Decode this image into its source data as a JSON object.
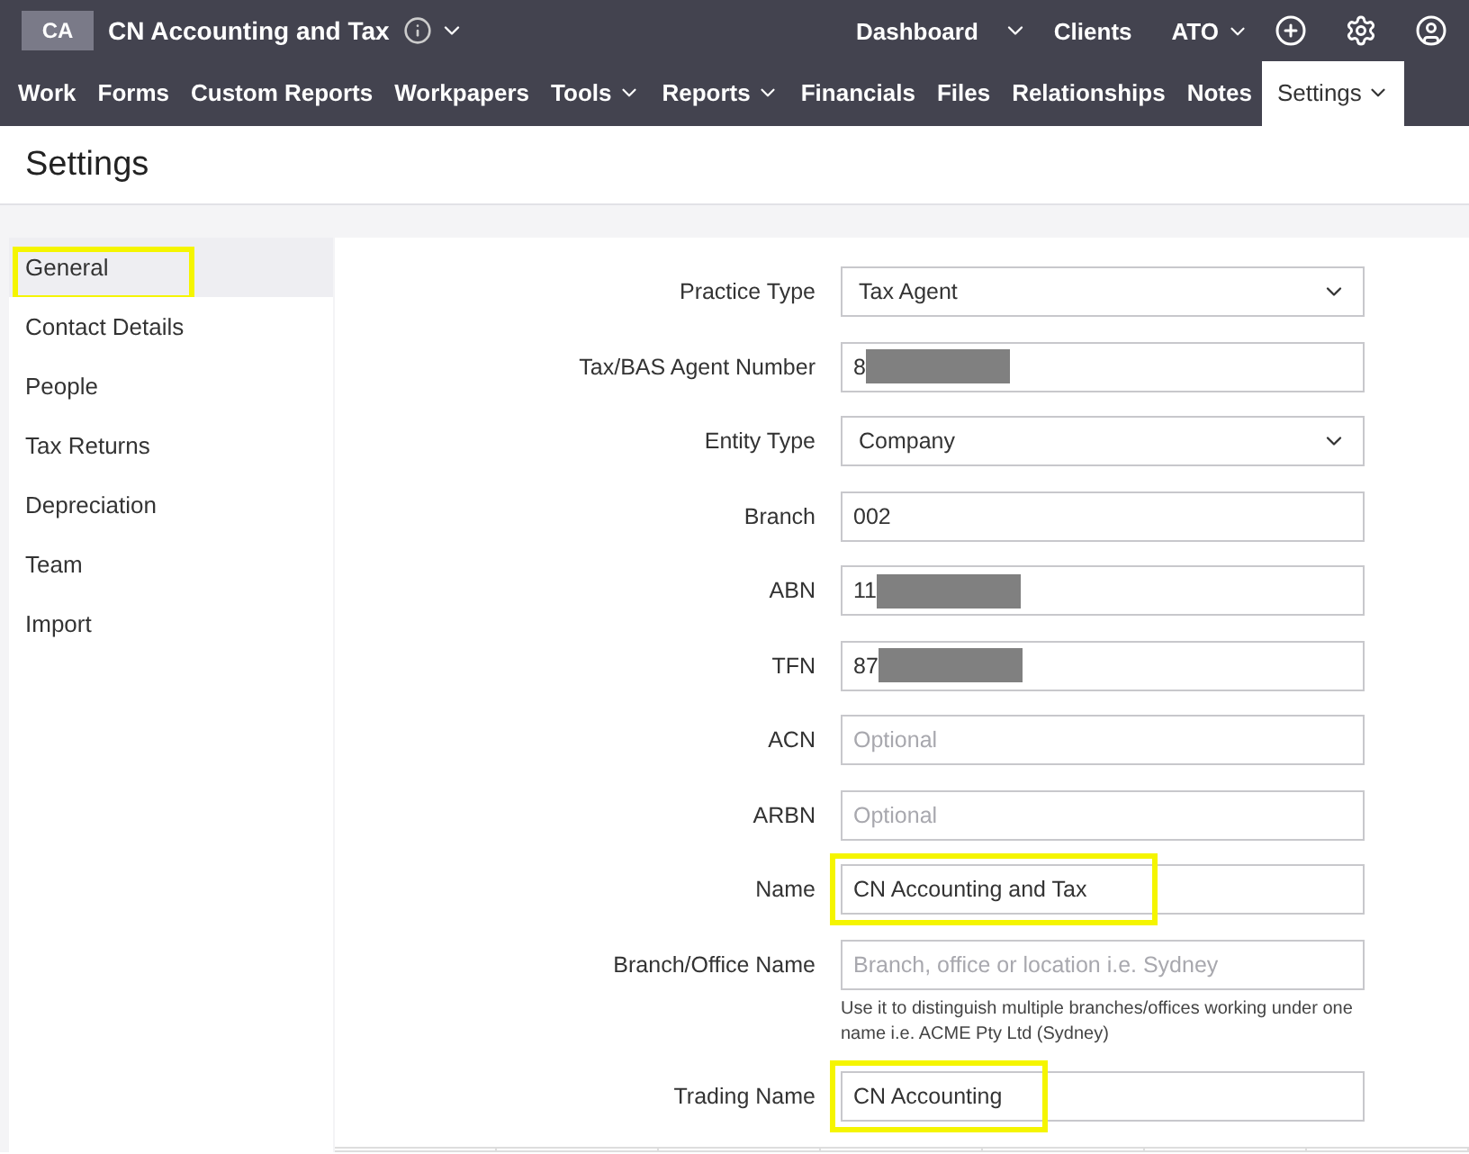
{
  "topbar": {
    "badge": "CA",
    "org": "CN Accounting and Tax",
    "links": [
      {
        "label": "Dashboard",
        "caret": false
      },
      {
        "label": "Clients",
        "caret": false
      },
      {
        "label": "ATO",
        "caret": true
      }
    ]
  },
  "nav": [
    {
      "label": "Work",
      "caret": false,
      "selected": false
    },
    {
      "label": "Forms",
      "caret": false,
      "selected": false
    },
    {
      "label": "Custom Reports",
      "caret": false,
      "selected": false
    },
    {
      "label": "Workpapers",
      "caret": false,
      "selected": false
    },
    {
      "label": "Tools",
      "caret": true,
      "selected": false
    },
    {
      "label": "Reports",
      "caret": true,
      "selected": false
    },
    {
      "label": "Financials",
      "caret": false,
      "selected": false
    },
    {
      "label": "Files",
      "caret": false,
      "selected": false
    },
    {
      "label": "Relationships",
      "caret": false,
      "selected": false
    },
    {
      "label": "Notes",
      "caret": false,
      "selected": false
    },
    {
      "label": "Settings",
      "caret": true,
      "selected": true
    }
  ],
  "page_title": "Settings",
  "sidebar": [
    {
      "label": "General",
      "selected": true,
      "highlighted": true
    },
    {
      "label": "Contact Details",
      "selected": false,
      "highlighted": false
    },
    {
      "label": "People",
      "selected": false,
      "highlighted": false
    },
    {
      "label": "Tax Returns",
      "selected": false,
      "highlighted": false
    },
    {
      "label": "Depreciation",
      "selected": false,
      "highlighted": false
    },
    {
      "label": "Team",
      "selected": false,
      "highlighted": false
    },
    {
      "label": "Import",
      "selected": false,
      "highlighted": false
    }
  ],
  "fields": [
    {
      "label": "Practice Type",
      "kind": "select",
      "value": "Tax Agent",
      "redacted": false,
      "highlighted": false
    },
    {
      "label": "Tax/BAS Agent Number",
      "kind": "text",
      "value": "8",
      "redacted": true,
      "highlighted": false
    },
    {
      "label": "Entity Type",
      "kind": "select",
      "value": "Company",
      "redacted": false,
      "highlighted": false
    },
    {
      "label": "Branch",
      "kind": "text",
      "value": "002",
      "redacted": false,
      "highlighted": false
    },
    {
      "label": "ABN",
      "kind": "text",
      "value": "11",
      "redacted": true,
      "highlighted": false
    },
    {
      "label": "TFN",
      "kind": "text",
      "value": "87",
      "redacted": true,
      "highlighted": false
    },
    {
      "label": "ACN",
      "kind": "text",
      "placeholder": "Optional",
      "redacted": false,
      "highlighted": false
    },
    {
      "label": "ARBN",
      "kind": "text",
      "placeholder": "Optional",
      "redacted": false,
      "highlighted": false
    },
    {
      "label": "Name",
      "kind": "text",
      "value": "CN Accounting and Tax",
      "redacted": false,
      "highlighted": true
    },
    {
      "label": "Branch/Office Name",
      "kind": "text",
      "placeholder": "Branch, office or location i.e. Sydney",
      "hint": "Use it to distinguish multiple branches/offices working under one name i.e. ACME Pty Ltd (Sydney)",
      "redacted": false,
      "highlighted": false
    },
    {
      "label": "Trading Name",
      "kind": "text",
      "value": "CN Accounting",
      "redacted": false,
      "highlighted": true
    }
  ]
}
